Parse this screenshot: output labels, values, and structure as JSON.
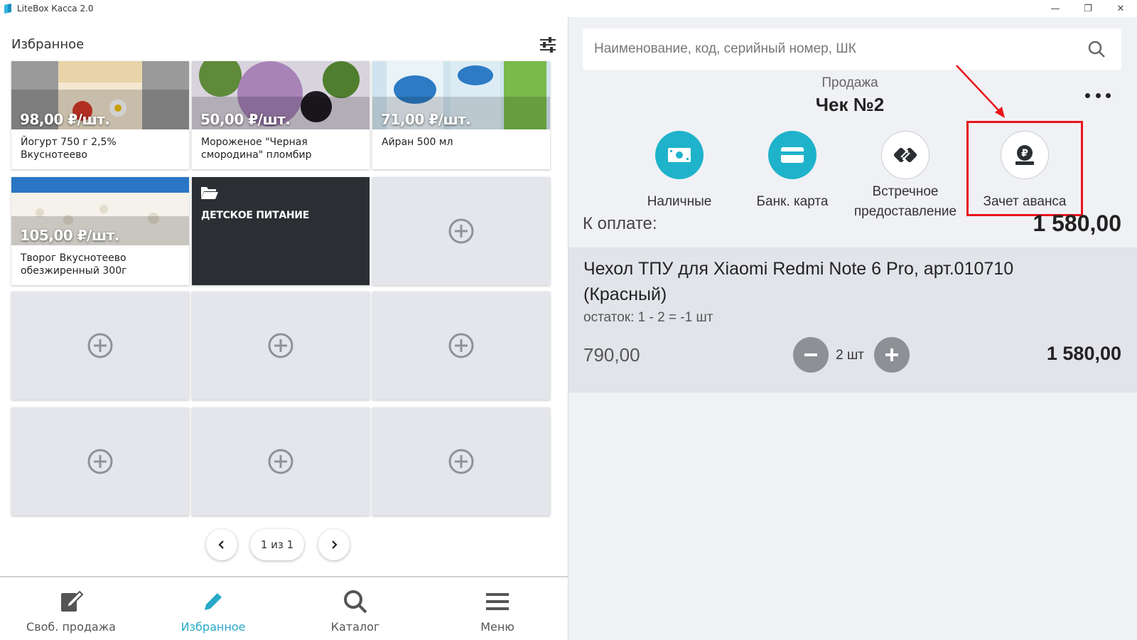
{
  "window": {
    "title": "LiteBox Касса 2.0",
    "minimize_label": "—",
    "restore_label": "❐",
    "close_label": "✕"
  },
  "favorites": {
    "title": "Избранное",
    "tiles": [
      {
        "price": "98,00 ₽/шт.",
        "name": "Йогурт 750 г 2,5% Вкуснотеево"
      },
      {
        "price": "50,00 ₽/шт.",
        "name": "Мороженое \"Черная смородина\" пломбир"
      },
      {
        "price": "71,00 ₽/шт.",
        "name": "Айран 500 мл"
      },
      {
        "price": "105,00 ₽/шт.",
        "name": "Творог Вкуснотеево обезжиренный 300г"
      }
    ],
    "folder": {
      "name": "ДЕТСКОЕ ПИТАНИЕ"
    },
    "pager": {
      "label": "1 из 1"
    }
  },
  "bottom_nav": [
    {
      "label": "Своб. продажа",
      "icon": "edit-note-icon",
      "active": false
    },
    {
      "label": "Избранное",
      "icon": "pencil-icon",
      "active": true
    },
    {
      "label": "Каталог",
      "icon": "search-icon",
      "active": false
    },
    {
      "label": "Меню",
      "icon": "menu-icon",
      "active": false
    }
  ],
  "sale": {
    "search_placeholder": "Наименование, код, серийный номер, ШК",
    "mode": "Продажа",
    "check_title": "Чек №2",
    "payments": [
      {
        "label": "Наличные",
        "icon": "cash-icon"
      },
      {
        "label": "Банк. карта",
        "icon": "card-icon"
      },
      {
        "label": "Встречное предоставление",
        "icon": "exchange-icon"
      },
      {
        "label": "Зачет аванса",
        "icon": "advance-ruble-icon"
      }
    ],
    "to_pay_label": "К оплате:",
    "to_pay_value": "1 580,00",
    "item": {
      "name": "Чехол ТПУ для Xiaomi Redmi Note 6 Pro, арт.010710 (Красный)",
      "rest": "остаток: 1 - 2 = -1 шт",
      "price": "790,00",
      "qty": "2 шт",
      "sum": "1 580,00"
    }
  },
  "colors": {
    "accent": "#27a9c7",
    "pay_teal": "#1fb3cb",
    "highlight_red": "#e8141a",
    "folder_dark": "#2b2f33"
  }
}
